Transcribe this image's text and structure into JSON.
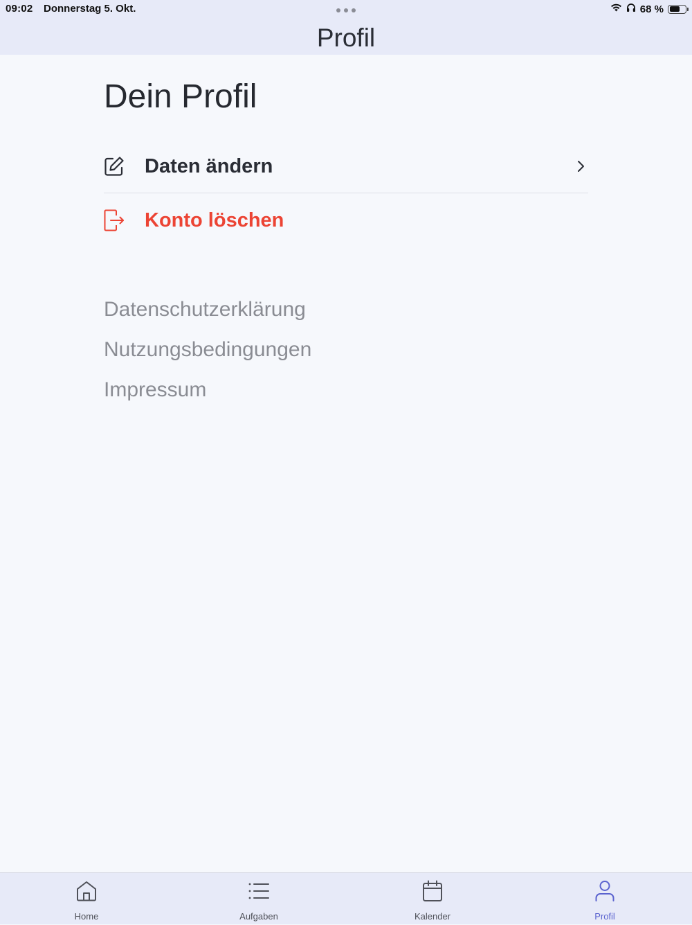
{
  "status_bar": {
    "time": "09:02",
    "date": "Donnerstag 5. Okt.",
    "battery_percent": "68 %",
    "battery_level": 0.68
  },
  "nav": {
    "title": "Profil"
  },
  "main": {
    "heading": "Dein Profil",
    "actions": [
      {
        "label": "Daten ändern",
        "icon": "edit-icon"
      },
      {
        "label": "Konto löschen",
        "icon": "logout-icon",
        "color": "#ec4434"
      }
    ],
    "legal_links": [
      "Datenschutzerklärung",
      "Nutzungsbedingungen",
      "Impressum"
    ]
  },
  "tab_bar": {
    "active_color": "#5b63cf",
    "tabs": [
      {
        "label": "Home",
        "icon": "home-icon"
      },
      {
        "label": "Aufgaben",
        "icon": "list-icon"
      },
      {
        "label": "Kalender",
        "icon": "calendar-icon"
      },
      {
        "label": "Profil",
        "icon": "user-icon",
        "active": true
      }
    ]
  }
}
